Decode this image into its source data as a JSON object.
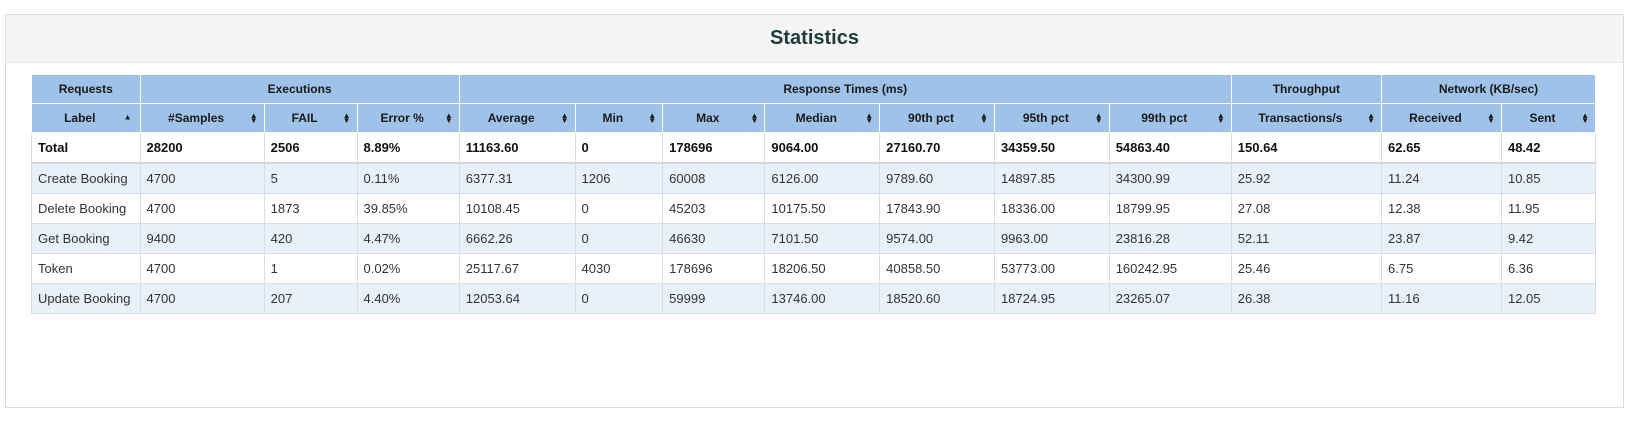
{
  "title": "Statistics",
  "group_headers": [
    {
      "label": "Requests",
      "span": 1
    },
    {
      "label": "Executions",
      "span": 3
    },
    {
      "label": "Response Times (ms)",
      "span": 7
    },
    {
      "label": "Throughput",
      "span": 1
    },
    {
      "label": "Network (KB/sec)",
      "span": 2
    }
  ],
  "columns": [
    "Label",
    "#Samples",
    "FAIL",
    "Error %",
    "Average",
    "Min",
    "Max",
    "Median",
    "90th pct",
    "95th pct",
    "99th pct",
    "Transactions/s",
    "Received",
    "Sent"
  ],
  "total": [
    "Total",
    "28200",
    "2506",
    "8.89%",
    "11163.60",
    "0",
    "178696",
    "9064.00",
    "27160.70",
    "34359.50",
    "54863.40",
    "150.64",
    "62.65",
    "48.42"
  ],
  "rows": [
    [
      "Create Booking",
      "4700",
      "5",
      "0.11%",
      "6377.31",
      "1206",
      "60008",
      "6126.00",
      "9789.60",
      "14897.85",
      "34300.99",
      "25.92",
      "11.24",
      "10.85"
    ],
    [
      "Delete Booking",
      "4700",
      "1873",
      "39.85%",
      "10108.45",
      "0",
      "45203",
      "10175.50",
      "17843.90",
      "18336.00",
      "18799.95",
      "27.08",
      "12.38",
      "11.95"
    ],
    [
      "Get Booking",
      "9400",
      "420",
      "4.47%",
      "6662.26",
      "0",
      "46630",
      "7101.50",
      "9574.00",
      "9963.00",
      "23816.28",
      "52.11",
      "23.87",
      "9.42"
    ],
    [
      "Token",
      "4700",
      "1",
      "0.02%",
      "25117.67",
      "4030",
      "178696",
      "18206.50",
      "40858.50",
      "53773.00",
      "160242.95",
      "25.46",
      "6.75",
      "6.36"
    ],
    [
      "Update Booking",
      "4700",
      "207",
      "4.40%",
      "12053.64",
      "0",
      "59999",
      "13746.00",
      "18520.60",
      "18724.95",
      "23265.07",
      "26.38",
      "11.16",
      "12.05"
    ]
  ]
}
